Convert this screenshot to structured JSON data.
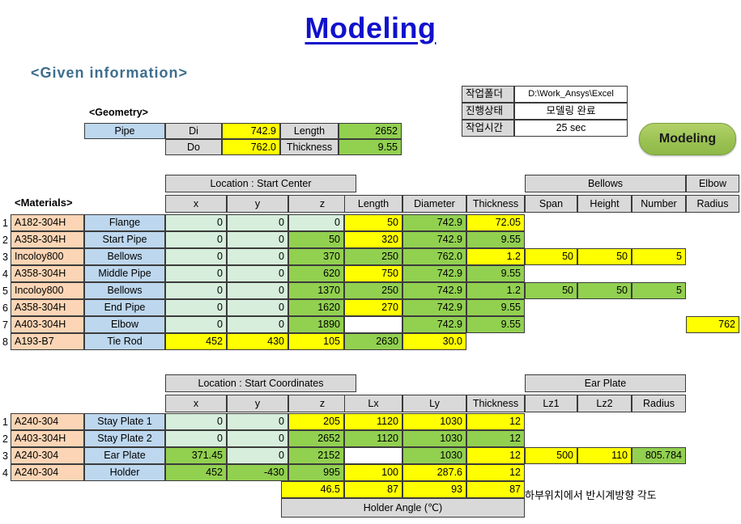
{
  "title": "Modeling",
  "section_given": "<Given information>",
  "section_geometry": "<Geometry>",
  "section_materials": "<Materials>",
  "modeling_badge": "Modeling",
  "note_korean": "하부위치에서 반시계방향 각도",
  "colors": {
    "title": "#1111cc",
    "heading": "#3d6e8e",
    "header_fill": "#d9d9d9",
    "yellow": "#ffff00",
    "green": "#92d050",
    "light_green": "#d6eedb",
    "blue": "#bdd7ee",
    "orange": "#fbd5b5",
    "badge": "#9bc253"
  },
  "status_table": {
    "rows": [
      {
        "label": "작업폴더",
        "value": "D:\\Work_Ansys\\Excel"
      },
      {
        "label": "진행상태",
        "value": "모델링 완료"
      },
      {
        "label": "작업시간",
        "value": "25 sec"
      }
    ]
  },
  "geometry_table": {
    "name": "Pipe",
    "rows": [
      {
        "k1": "Di",
        "v1": "742.9",
        "k2": "Length",
        "v2": "2652"
      },
      {
        "k1": "Do",
        "v1": "762.0",
        "k2": "Thickness",
        "v2": "9.55"
      }
    ]
  },
  "materials_table": {
    "group_headers": [
      {
        "label": "Location : Start Center"
      },
      {
        "label": "Bellows"
      },
      {
        "label": "Elbow"
      }
    ],
    "columns": [
      "x",
      "y",
      "z",
      "Length",
      "Diameter",
      "Thickness",
      "Span",
      "Height",
      "Number",
      "Radius"
    ],
    "rows": [
      {
        "n": "1",
        "material": "A182-304H",
        "component": "Flange",
        "x": "0",
        "y": "0",
        "z": "0",
        "length": "50",
        "diameter": "742.9",
        "thickness": "72.05",
        "span": "",
        "height": "",
        "number": "",
        "radius": ""
      },
      {
        "n": "2",
        "material": "A358-304H",
        "component": "Start Pipe",
        "x": "0",
        "y": "0",
        "z": "50",
        "length": "320",
        "diameter": "742.9",
        "thickness": "9.55",
        "span": "",
        "height": "",
        "number": "",
        "radius": ""
      },
      {
        "n": "3",
        "material": "Incoloy800",
        "component": "Bellows",
        "x": "0",
        "y": "0",
        "z": "370",
        "length": "250",
        "diameter": "762.0",
        "thickness": "1.2",
        "span": "50",
        "height": "50",
        "number": "5",
        "radius": ""
      },
      {
        "n": "4",
        "material": "A358-304H",
        "component": "Middle Pipe",
        "x": "0",
        "y": "0",
        "z": "620",
        "length": "750",
        "diameter": "742.9",
        "thickness": "9.55",
        "span": "",
        "height": "",
        "number": "",
        "radius": ""
      },
      {
        "n": "5",
        "material": "Incoloy800",
        "component": "Bellows",
        "x": "0",
        "y": "0",
        "z": "1370",
        "length": "250",
        "diameter": "742.9",
        "thickness": "1.2",
        "span": "50",
        "height": "50",
        "number": "5",
        "radius": ""
      },
      {
        "n": "6",
        "material": "A358-304H",
        "component": "End Pipe",
        "x": "0",
        "y": "0",
        "z": "1620",
        "length": "270",
        "diameter": "742.9",
        "thickness": "9.55",
        "span": "",
        "height": "",
        "number": "",
        "radius": ""
      },
      {
        "n": "7",
        "material": "A403-304H",
        "component": "Elbow",
        "x": "0",
        "y": "0",
        "z": "1890",
        "length": "",
        "diameter": "742.9",
        "thickness": "9.55",
        "span": "",
        "height": "",
        "number": "",
        "radius": "762"
      },
      {
        "n": "8",
        "material": "A193-B7",
        "component": "Tie Rod",
        "x": "452",
        "y": "430",
        "z": "105",
        "length": "2630",
        "diameter": "30.0",
        "thickness": "",
        "span": "",
        "height": "",
        "number": "",
        "radius": ""
      }
    ]
  },
  "coordinates_table": {
    "group_headers": [
      {
        "label": "Location : Start Coordinates"
      },
      {
        "label": "Ear Plate"
      }
    ],
    "columns": [
      "x",
      "y",
      "z",
      "Lx",
      "Ly",
      "Thickness",
      "Lz1",
      "Lz2",
      "Radius"
    ],
    "rows": [
      {
        "n": "1",
        "material": "A240-304",
        "component": "Stay Plate 1",
        "x": "0",
        "y": "0",
        "z": "205",
        "lx": "1120",
        "ly": "1030",
        "thickness": "12",
        "lz1": "",
        "lz2": "",
        "radius": ""
      },
      {
        "n": "2",
        "material": "A403-304H",
        "component": "Stay Plate 2",
        "x": "0",
        "y": "0",
        "z": "2652",
        "lx": "1120",
        "ly": "1030",
        "thickness": "12",
        "lz1": "",
        "lz2": "",
        "radius": ""
      },
      {
        "n": "3",
        "material": "A240-304",
        "component": "Ear Plate",
        "x": "371.45",
        "y": "0",
        "z": "2152",
        "lx": "",
        "ly": "1030",
        "thickness": "12",
        "lz1": "500",
        "lz2": "110",
        "radius": "805.784"
      },
      {
        "n": "4",
        "material": "A240-304",
        "component": "Holder",
        "x": "452",
        "y": "-430",
        "z": "995",
        "lx": "100",
        "ly": "287.6",
        "thickness": "12",
        "lz1": "",
        "lz2": "",
        "radius": ""
      }
    ],
    "angle_row": {
      "z": "46.5",
      "lx": "87",
      "ly": "93",
      "thickness": "87"
    },
    "angle_label": "Holder Angle (℃)"
  }
}
